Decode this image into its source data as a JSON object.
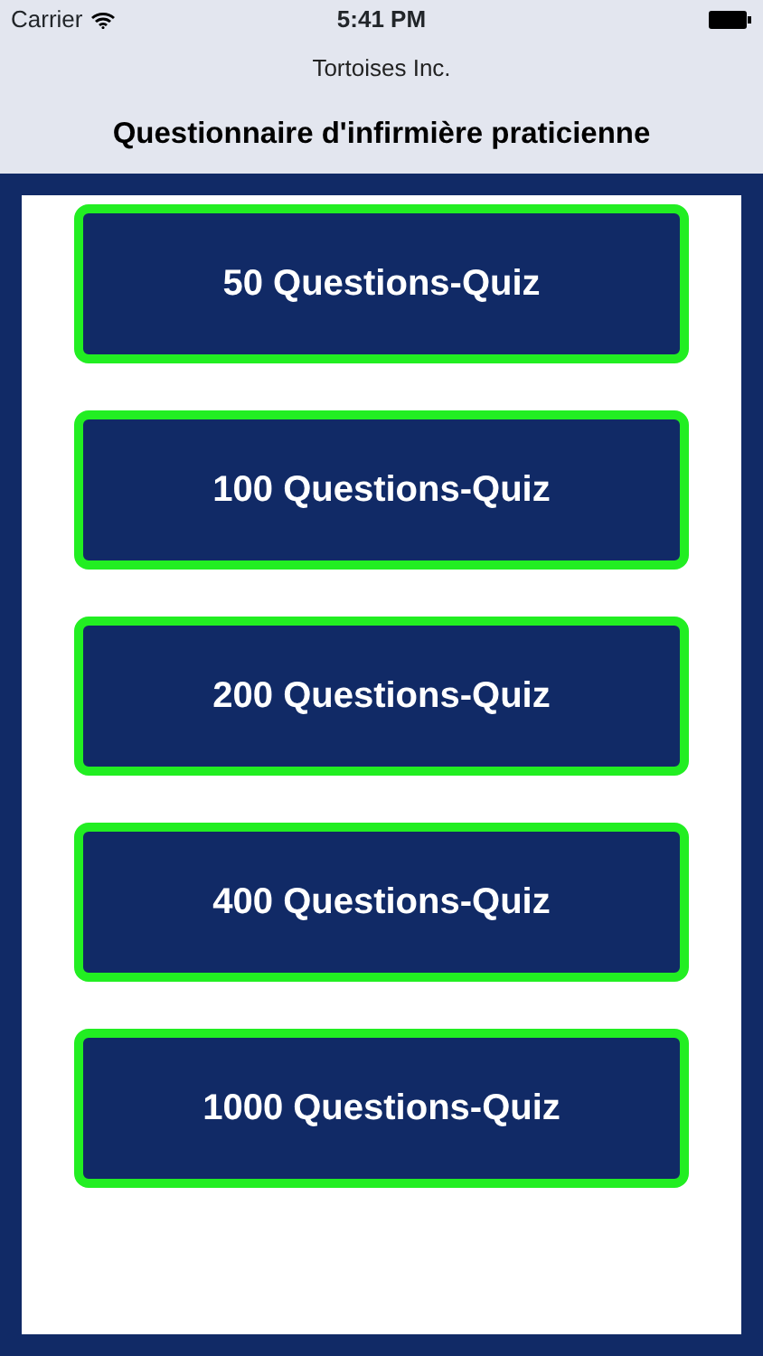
{
  "status_bar": {
    "carrier": "Carrier",
    "time": "5:41 PM"
  },
  "header": {
    "subtitle": "Tortoises Inc.",
    "title": "Questionnaire d'infirmière praticienne"
  },
  "buttons": [
    {
      "label": "50 Questions-Quiz"
    },
    {
      "label": "100 Questions-Quiz"
    },
    {
      "label": "200 Questions-Quiz"
    },
    {
      "label": "400 Questions-Quiz"
    },
    {
      "label": "1000 Questions-Quiz"
    }
  ]
}
